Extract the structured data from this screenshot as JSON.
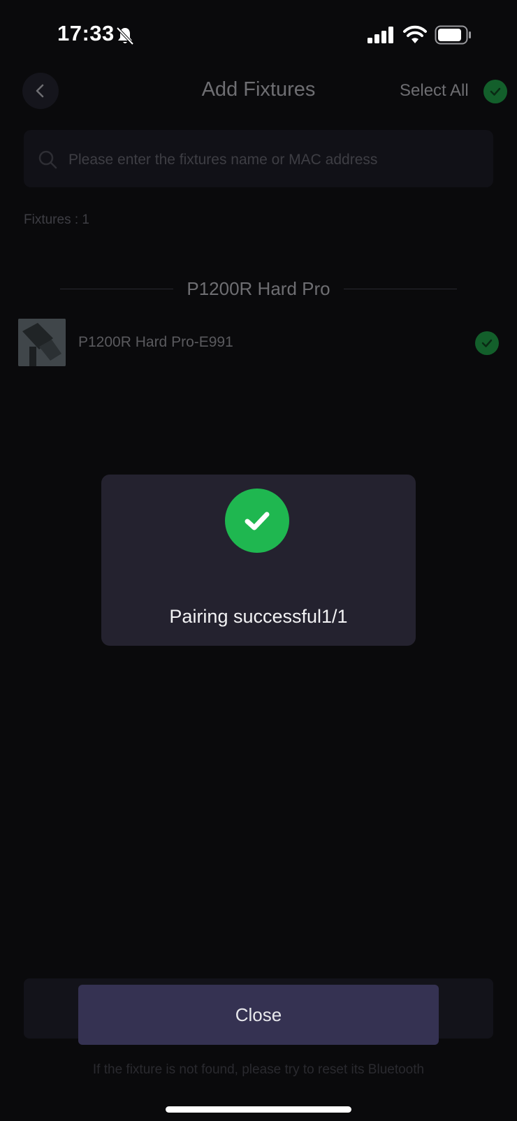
{
  "status_bar": {
    "time": "17:33",
    "icons": [
      "bell-slash-icon",
      "signal-icon",
      "wifi-icon",
      "battery-icon"
    ]
  },
  "header": {
    "back_icon": "chevron-left-icon",
    "title": "Add Fixtures",
    "select_all_label": "Select All",
    "select_all_checked": true
  },
  "search": {
    "icon": "search-icon",
    "placeholder": "Please enter the fixtures name or MAC address",
    "value": ""
  },
  "fixtures_count": "Fixtures : 1",
  "group": {
    "title": "P1200R Hard Pro",
    "fixtures": [
      {
        "name": "P1200R Hard Pro-E991",
        "checked": true
      }
    ]
  },
  "toast": {
    "icon": "check-circle-icon",
    "message": "Pairing successful1/1"
  },
  "close_button_label": "Close",
  "hint": "If the fixture is not found, please try to reset its Bluetooth",
  "colors": {
    "background": "#0a0a0c",
    "success_green": "#1fb750",
    "check_green_dim": "#135f2b",
    "button_purple": "#353252",
    "toast_bg": "#24222f"
  }
}
